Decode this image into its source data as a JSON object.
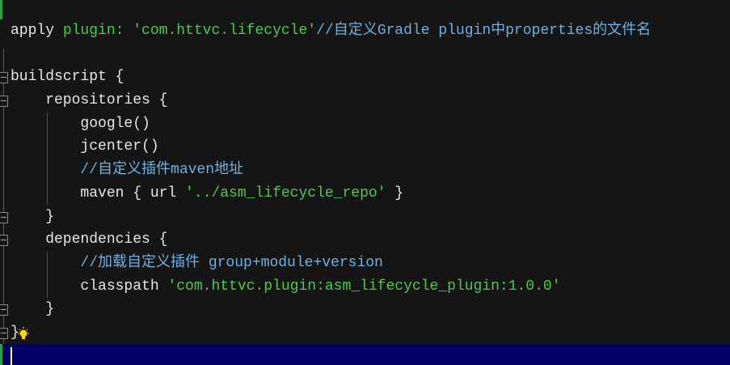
{
  "colors": {
    "background": "#151515",
    "string": "#4ec94e",
    "comment": "#6fb0e0",
    "current_line": "#000066"
  },
  "lines": [
    [
      {
        "t": "apply ",
        "c": ""
      },
      {
        "t": "plugin:",
        "c": "kw"
      },
      {
        "t": " ",
        "c": ""
      },
      {
        "t": "'com.httvc.lifecycle'",
        "c": "str"
      },
      {
        "t": "//自定义Gradle plugin中properties的文件名",
        "c": "cmt"
      }
    ],
    [],
    [
      {
        "t": "buildscript {",
        "c": ""
      }
    ],
    [
      {
        "t": "    repositories {",
        "c": ""
      }
    ],
    [
      {
        "t": "        google()",
        "c": ""
      }
    ],
    [
      {
        "t": "        jcenter()",
        "c": ""
      }
    ],
    [
      {
        "t": "        ",
        "c": ""
      },
      {
        "t": "//自定义插件maven地址",
        "c": "cmt"
      }
    ],
    [
      {
        "t": "        maven { url ",
        "c": ""
      },
      {
        "t": "'../asm_lifecycle_repo'",
        "c": "str"
      },
      {
        "t": " }",
        "c": ""
      }
    ],
    [
      {
        "t": "    }",
        "c": ""
      }
    ],
    [
      {
        "t": "    dependencies {",
        "c": ""
      }
    ],
    [
      {
        "t": "        ",
        "c": ""
      },
      {
        "t": "//加载自定义插件 group+module+version",
        "c": "cmt"
      }
    ],
    [
      {
        "t": "        classpath ",
        "c": ""
      },
      {
        "t": "'com.httvc.plugin:asm_lifecycle_plugin:1.0.0'",
        "c": "str"
      }
    ],
    [
      {
        "t": "    }",
        "c": ""
      }
    ],
    [
      {
        "t": "}",
        "c": ""
      }
    ]
  ],
  "fold_lines": [
    2,
    3,
    8,
    9,
    12,
    13
  ],
  "icons": {
    "lightbulb": "lightbulb-icon"
  }
}
